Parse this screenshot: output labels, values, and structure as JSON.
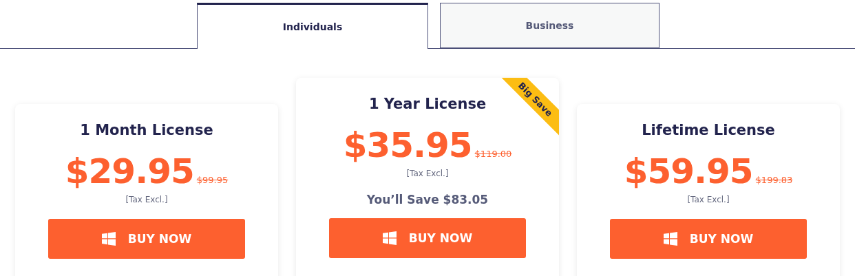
{
  "tabs": [
    {
      "label": "Individuals",
      "selected": true
    },
    {
      "label": "Business",
      "selected": false
    }
  ],
  "plans": [
    {
      "title": "1 Month License",
      "price": "$29.95",
      "old_price": "$99.95",
      "tax_note": "[Tax Excl.]",
      "button": "BUY NOW",
      "featured": false
    },
    {
      "title": "1 Year License",
      "price": "$35.95",
      "old_price": "$119.00",
      "tax_note": "[Tax Excl.]",
      "savings": "You’ll Save $83.05",
      "badge": "Big Save",
      "button": "BUY NOW",
      "featured": true
    },
    {
      "title": "Lifetime License",
      "price": "$59.95",
      "old_price": "$199.83",
      "tax_note": "[Tax Excl.]",
      "button": "BUY NOW",
      "featured": false
    }
  ]
}
